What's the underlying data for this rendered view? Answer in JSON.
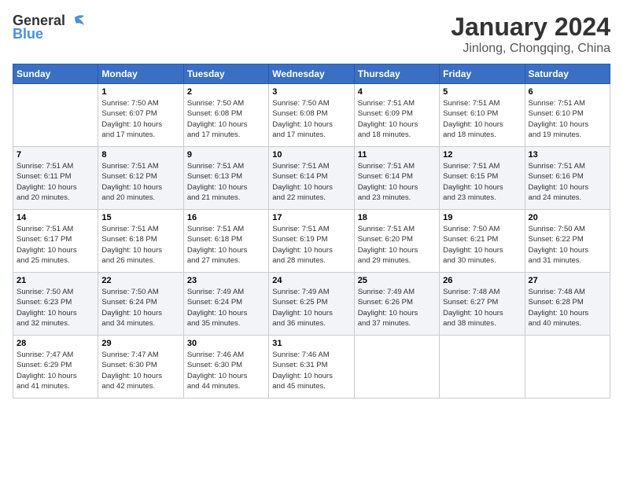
{
  "logo": {
    "general": "General",
    "blue": "Blue"
  },
  "header": {
    "month": "January 2024",
    "location": "Jinlong, Chongqing, China"
  },
  "weekdays": [
    "Sunday",
    "Monday",
    "Tuesday",
    "Wednesday",
    "Thursday",
    "Friday",
    "Saturday"
  ],
  "weeks": [
    [
      {
        "day": "",
        "sunrise": "",
        "sunset": "",
        "daylight": ""
      },
      {
        "day": "1",
        "sunrise": "Sunrise: 7:50 AM",
        "sunset": "Sunset: 6:07 PM",
        "daylight": "Daylight: 10 hours and 17 minutes."
      },
      {
        "day": "2",
        "sunrise": "Sunrise: 7:50 AM",
        "sunset": "Sunset: 6:08 PM",
        "daylight": "Daylight: 10 hours and 17 minutes."
      },
      {
        "day": "3",
        "sunrise": "Sunrise: 7:50 AM",
        "sunset": "Sunset: 6:08 PM",
        "daylight": "Daylight: 10 hours and 17 minutes."
      },
      {
        "day": "4",
        "sunrise": "Sunrise: 7:51 AM",
        "sunset": "Sunset: 6:09 PM",
        "daylight": "Daylight: 10 hours and 18 minutes."
      },
      {
        "day": "5",
        "sunrise": "Sunrise: 7:51 AM",
        "sunset": "Sunset: 6:10 PM",
        "daylight": "Daylight: 10 hours and 18 minutes."
      },
      {
        "day": "6",
        "sunrise": "Sunrise: 7:51 AM",
        "sunset": "Sunset: 6:10 PM",
        "daylight": "Daylight: 10 hours and 19 minutes."
      }
    ],
    [
      {
        "day": "7",
        "sunrise": "Sunrise: 7:51 AM",
        "sunset": "Sunset: 6:11 PM",
        "daylight": "Daylight: 10 hours and 20 minutes."
      },
      {
        "day": "8",
        "sunrise": "Sunrise: 7:51 AM",
        "sunset": "Sunset: 6:12 PM",
        "daylight": "Daylight: 10 hours and 20 minutes."
      },
      {
        "day": "9",
        "sunrise": "Sunrise: 7:51 AM",
        "sunset": "Sunset: 6:13 PM",
        "daylight": "Daylight: 10 hours and 21 minutes."
      },
      {
        "day": "10",
        "sunrise": "Sunrise: 7:51 AM",
        "sunset": "Sunset: 6:14 PM",
        "daylight": "Daylight: 10 hours and 22 minutes."
      },
      {
        "day": "11",
        "sunrise": "Sunrise: 7:51 AM",
        "sunset": "Sunset: 6:14 PM",
        "daylight": "Daylight: 10 hours and 23 minutes."
      },
      {
        "day": "12",
        "sunrise": "Sunrise: 7:51 AM",
        "sunset": "Sunset: 6:15 PM",
        "daylight": "Daylight: 10 hours and 23 minutes."
      },
      {
        "day": "13",
        "sunrise": "Sunrise: 7:51 AM",
        "sunset": "Sunset: 6:16 PM",
        "daylight": "Daylight: 10 hours and 24 minutes."
      }
    ],
    [
      {
        "day": "14",
        "sunrise": "Sunrise: 7:51 AM",
        "sunset": "Sunset: 6:17 PM",
        "daylight": "Daylight: 10 hours and 25 minutes."
      },
      {
        "day": "15",
        "sunrise": "Sunrise: 7:51 AM",
        "sunset": "Sunset: 6:18 PM",
        "daylight": "Daylight: 10 hours and 26 minutes."
      },
      {
        "day": "16",
        "sunrise": "Sunrise: 7:51 AM",
        "sunset": "Sunset: 6:18 PM",
        "daylight": "Daylight: 10 hours and 27 minutes."
      },
      {
        "day": "17",
        "sunrise": "Sunrise: 7:51 AM",
        "sunset": "Sunset: 6:19 PM",
        "daylight": "Daylight: 10 hours and 28 minutes."
      },
      {
        "day": "18",
        "sunrise": "Sunrise: 7:51 AM",
        "sunset": "Sunset: 6:20 PM",
        "daylight": "Daylight: 10 hours and 29 minutes."
      },
      {
        "day": "19",
        "sunrise": "Sunrise: 7:50 AM",
        "sunset": "Sunset: 6:21 PM",
        "daylight": "Daylight: 10 hours and 30 minutes."
      },
      {
        "day": "20",
        "sunrise": "Sunrise: 7:50 AM",
        "sunset": "Sunset: 6:22 PM",
        "daylight": "Daylight: 10 hours and 31 minutes."
      }
    ],
    [
      {
        "day": "21",
        "sunrise": "Sunrise: 7:50 AM",
        "sunset": "Sunset: 6:23 PM",
        "daylight": "Daylight: 10 hours and 32 minutes."
      },
      {
        "day": "22",
        "sunrise": "Sunrise: 7:50 AM",
        "sunset": "Sunset: 6:24 PM",
        "daylight": "Daylight: 10 hours and 34 minutes."
      },
      {
        "day": "23",
        "sunrise": "Sunrise: 7:49 AM",
        "sunset": "Sunset: 6:24 PM",
        "daylight": "Daylight: 10 hours and 35 minutes."
      },
      {
        "day": "24",
        "sunrise": "Sunrise: 7:49 AM",
        "sunset": "Sunset: 6:25 PM",
        "daylight": "Daylight: 10 hours and 36 minutes."
      },
      {
        "day": "25",
        "sunrise": "Sunrise: 7:49 AM",
        "sunset": "Sunset: 6:26 PM",
        "daylight": "Daylight: 10 hours and 37 minutes."
      },
      {
        "day": "26",
        "sunrise": "Sunrise: 7:48 AM",
        "sunset": "Sunset: 6:27 PM",
        "daylight": "Daylight: 10 hours and 38 minutes."
      },
      {
        "day": "27",
        "sunrise": "Sunrise: 7:48 AM",
        "sunset": "Sunset: 6:28 PM",
        "daylight": "Daylight: 10 hours and 40 minutes."
      }
    ],
    [
      {
        "day": "28",
        "sunrise": "Sunrise: 7:47 AM",
        "sunset": "Sunset: 6:29 PM",
        "daylight": "Daylight: 10 hours and 41 minutes."
      },
      {
        "day": "29",
        "sunrise": "Sunrise: 7:47 AM",
        "sunset": "Sunset: 6:30 PM",
        "daylight": "Daylight: 10 hours and 42 minutes."
      },
      {
        "day": "30",
        "sunrise": "Sunrise: 7:46 AM",
        "sunset": "Sunset: 6:30 PM",
        "daylight": "Daylight: 10 hours and 44 minutes."
      },
      {
        "day": "31",
        "sunrise": "Sunrise: 7:46 AM",
        "sunset": "Sunset: 6:31 PM",
        "daylight": "Daylight: 10 hours and 45 minutes."
      },
      {
        "day": "",
        "sunrise": "",
        "sunset": "",
        "daylight": ""
      },
      {
        "day": "",
        "sunrise": "",
        "sunset": "",
        "daylight": ""
      },
      {
        "day": "",
        "sunrise": "",
        "sunset": "",
        "daylight": ""
      }
    ]
  ]
}
